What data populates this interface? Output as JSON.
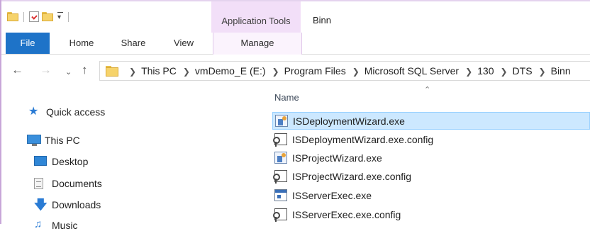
{
  "titlebar": {
    "contextual_tab_label": "Application Tools",
    "window_title": "Binn"
  },
  "ribbon": {
    "tabs": [
      {
        "label": "File"
      },
      {
        "label": "Home"
      },
      {
        "label": "Share"
      },
      {
        "label": "View"
      },
      {
        "label": "Manage"
      }
    ]
  },
  "address_bar": {
    "path": [
      "This PC",
      "vmDemo_E (E:)",
      "Program Files",
      "Microsoft SQL Server",
      "130",
      "DTS",
      "Binn"
    ]
  },
  "nav_pane": {
    "items": [
      {
        "label": "Quick access",
        "icon": "star-icon"
      },
      {
        "label": "This PC",
        "icon": "computer-icon"
      },
      {
        "label": "Desktop",
        "icon": "desktop-icon"
      },
      {
        "label": "Documents",
        "icon": "documents-icon"
      },
      {
        "label": "Downloads",
        "icon": "downloads-icon"
      },
      {
        "label": "Music",
        "icon": "music-icon"
      }
    ]
  },
  "file_list": {
    "column_name": "Name",
    "files": [
      {
        "name": "ISDeploymentWizard.exe",
        "icon": "wizard-exe-icon",
        "selected": true
      },
      {
        "name": "ISDeploymentWizard.exe.config",
        "icon": "config-file-icon",
        "selected": false
      },
      {
        "name": "ISProjectWizard.exe",
        "icon": "wizard-exe-icon",
        "selected": false
      },
      {
        "name": "ISProjectWizard.exe.config",
        "icon": "config-file-icon",
        "selected": false
      },
      {
        "name": "ISServerExec.exe",
        "icon": "app-exe-icon",
        "selected": false
      },
      {
        "name": "ISServerExec.exe.config",
        "icon": "config-file-icon",
        "selected": false
      }
    ]
  },
  "colors": {
    "file_tab": "#1e73c8",
    "contextual_tab": "#f2dff8",
    "selection": "#cce8ff"
  }
}
